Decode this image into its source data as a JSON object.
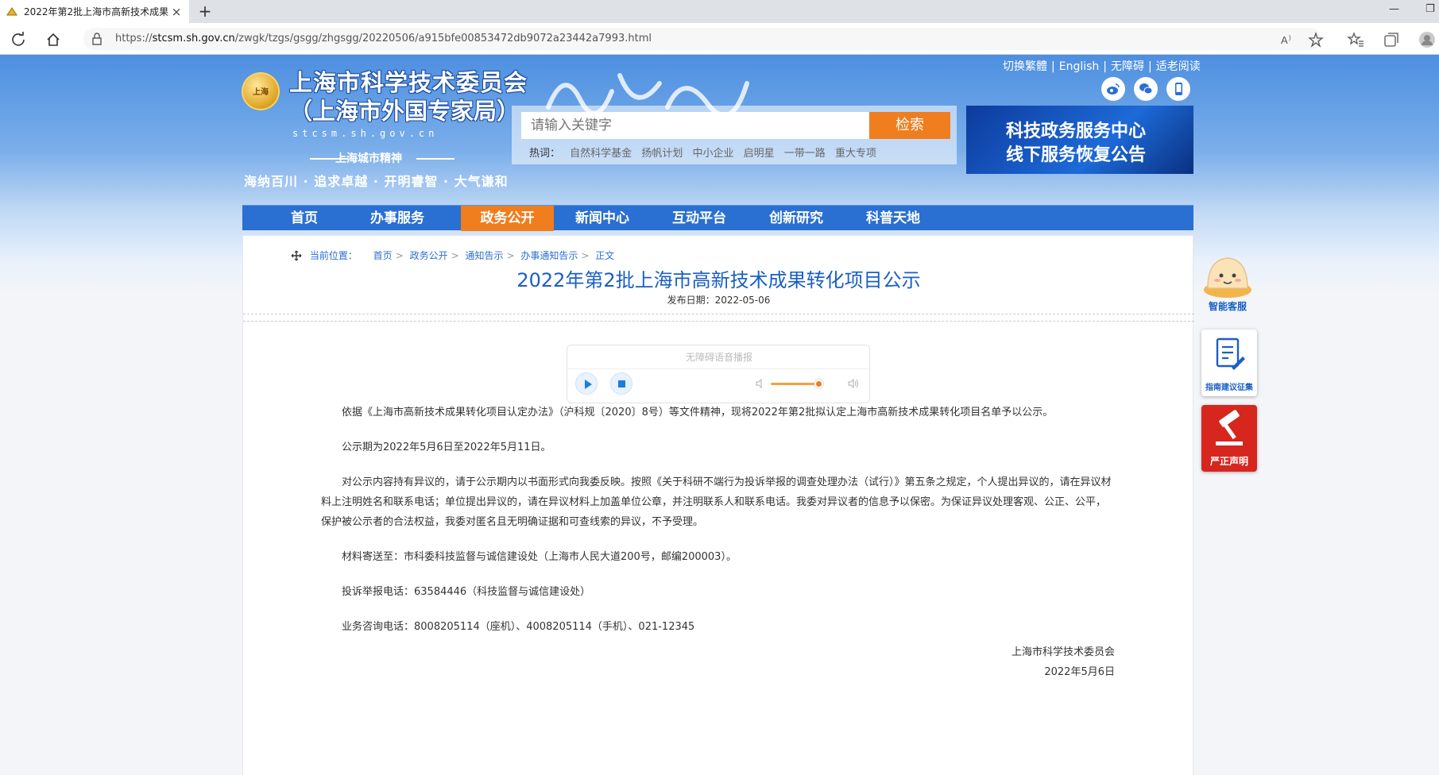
{
  "browser": {
    "tab_title": "2022年第2批上海市高新技术成果",
    "url_prefix": "https://",
    "url_host": "stcsm.sh.gov.cn",
    "url_path": "/zwgk/tzgs/gsgg/zhgsgg/20220506/a915bfe00853472db9072a23442a7993.html"
  },
  "header": {
    "org_name_line1": "上海市科学技术委员会",
    "org_name_line2": "（上海市外国专家局）",
    "domain": "stcsm.sh.gov.cn",
    "spirit_title": "上海城市精神",
    "spirit_text": "海纳百川 · 追求卓越 · 开明睿智 · 大气谦和",
    "top_links": [
      "切换繁體",
      "English",
      "无障碍",
      "适老阅读"
    ],
    "search_placeholder": "请输入关键字",
    "search_button": "检索",
    "hot_label": "热词：",
    "hot_words": [
      "自然科学基金",
      "扬帆计划",
      "中小企业",
      "启明星",
      "一带一路",
      "重大专项"
    ],
    "banner_line1": "科技政务服务中心",
    "banner_line2": "线下服务恢复公告"
  },
  "nav": [
    "首页",
    "办事服务",
    "政务公开",
    "新闻中心",
    "互动平台",
    "创新研究",
    "科普天地"
  ],
  "breadcrumb": {
    "label": "当前位置：",
    "items": [
      "首页",
      "政务公开",
      "通知告示",
      "办事通知告示",
      "正文"
    ]
  },
  "article": {
    "title": "2022年第2批上海市高新技术成果转化项目公示",
    "date": "发布日期：2022-05-06",
    "paragraphs": [
      "依据《上海市高新技术成果转化项目认定办法》（沪科规〔2020〕8号）等文件精神，现将2022年第2批拟认定上海市高新技术成果转化项目名单予以公示。",
      "公示期为2022年5月6日至2022年5月11日。",
      "对公示内容持有异议的，请于公示期内以书面形式向我委反映。按照《关于科研不端行为投诉举报的调查处理办法（试行）》第五条之规定，个人提出异议的，请在异议材料上注明姓名和联系电话；单位提出异议的，请在异议材料上加盖单位公章，并注明联系人和联系电话。我委对异议者的信息予以保密。为保证异议处理客观、公正、公平，保护被公示者的合法权益，我委对匿名且无明确证据和可查线索的异议，不予受理。",
      "材料寄送至：市科委科技监督与诚信建设处（上海市人民大道200号，邮编200003）。",
      "投诉举报电话：63584446（科技监督与诚信建设处）",
      "业务咨询电话：8008205114（座机）、4008205114（手机）、021-12345"
    ],
    "signature": "上海市科学技术委员会",
    "sign_date": "2022年5月6日"
  },
  "audio": {
    "caption": "无障碍语音播报",
    "volume": 0.85
  },
  "float": {
    "bot_label": "智能客服",
    "guide_label": "指南建议征集",
    "report_label": "严正声明"
  },
  "colors": {
    "primary_blue": "#2a6fd2",
    "accent_orange": "#f07d1e",
    "title_blue": "#1a5fc4",
    "report_red": "#d7261e"
  }
}
